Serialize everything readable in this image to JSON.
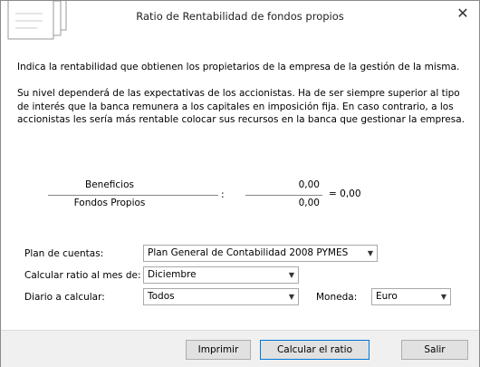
{
  "window": {
    "title": "Ratio de Rentabilidad de fondos propios"
  },
  "description": {
    "line1": "Indica la rentabilidad que obtienen los propietarios de la empresa de la gestión de la misma.",
    "line2": "Su nivel dependerá de las expectativas de los accionistas. Ha de ser siempre superior al tipo de interés que la banca remunera a los capitales en imposición fija. En caso contrario, a los accionistas les sería  más rentable colocar sus recursos en la banca que gestionar la empresa."
  },
  "formula": {
    "numerator_label": "Beneficios",
    "denominator_label": "Fondos Propios",
    "numerator_value": "0,00",
    "denominator_value": "0,00",
    "colon": ":",
    "result": "= 0,00"
  },
  "form": {
    "plan_label": "Plan de cuentas:",
    "plan_value": "Plan General de Contabilidad 2008 PYMES",
    "mes_label": "Calcular ratio al mes de:",
    "mes_value": "Diciembre",
    "diario_label": "Diario a calcular:",
    "diario_value": "Todos",
    "moneda_label": "Moneda:",
    "moneda_value": "Euro"
  },
  "buttons": {
    "print": "Imprimir",
    "calculate": "Calcular el ratio",
    "exit": "Salir"
  },
  "icons": {
    "close": "close-icon",
    "header": "documents-icon",
    "dropdown": "chevron-down-icon"
  }
}
